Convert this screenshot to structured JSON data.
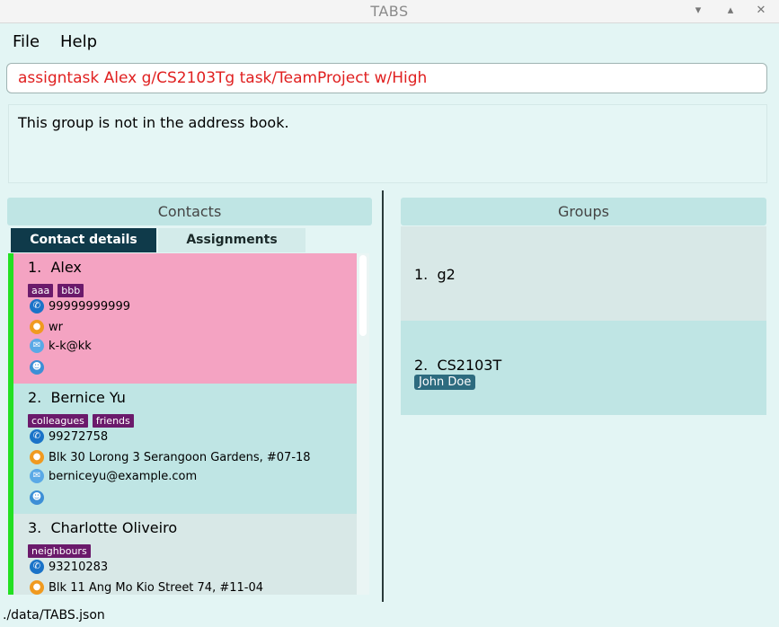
{
  "window": {
    "title": "TABS",
    "minimize": "▾",
    "maximize": "▴",
    "close": "✕"
  },
  "menu": {
    "file": "File",
    "help": "Help"
  },
  "command": {
    "value": "assigntask Alex g/CS2103Tg task/TeamProject w/High"
  },
  "result": {
    "message": "This group is not in the address book."
  },
  "contacts": {
    "header": "Contacts",
    "tabs": {
      "details": "Contact details",
      "assignments": "Assignments"
    },
    "items": [
      {
        "index": "1.",
        "name": "Alex",
        "tags": [
          "aaa",
          "bbb"
        ],
        "phone": "99999999999",
        "address": "wr",
        "email": "k-k@kk"
      },
      {
        "index": "2.",
        "name": "Bernice Yu",
        "tags": [
          "colleagues",
          "friends"
        ],
        "phone": "99272758",
        "address": "Blk 30 Lorong 3 Serangoon Gardens, #07-18",
        "email": "berniceyu@example.com"
      },
      {
        "index": "3.",
        "name": "Charlotte Oliveiro",
        "tags": [
          "neighbours"
        ],
        "phone": "93210283",
        "address": "Blk 11 Ang Mo Kio Street 74, #11-04"
      }
    ]
  },
  "groups": {
    "header": "Groups",
    "items": [
      {
        "index": "1.",
        "name": "g2",
        "members": []
      },
      {
        "index": "2.",
        "name": "CS2103T",
        "members": [
          "John Doe"
        ]
      }
    ]
  },
  "status": {
    "path": "./data/TABS.json"
  },
  "icons": {
    "phone": "phone-icon",
    "address": "location-pin-icon",
    "email": "envelope-icon",
    "group": "people-icon"
  },
  "colors": {
    "background": "#e3f5f4",
    "selected_card": "#f4a3c2",
    "accent_bar": "#22e022",
    "tag": "#6b1a6b",
    "active_tab": "#0f3a4a",
    "command_text": "#e02020",
    "member_badge": "#2d6b7f"
  }
}
